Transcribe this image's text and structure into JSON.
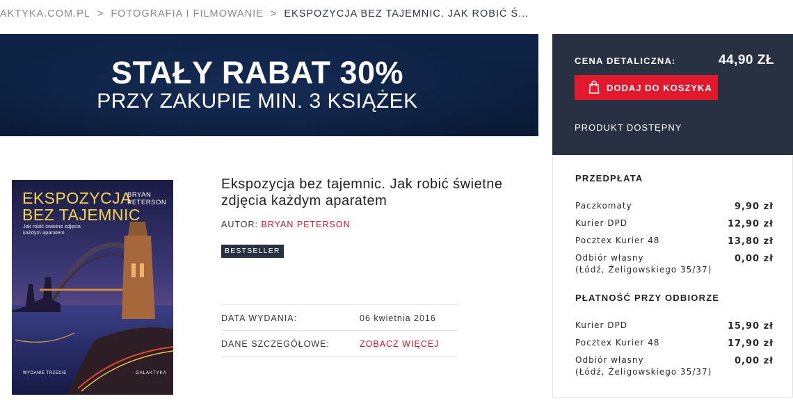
{
  "breadcrumb": {
    "items": [
      "AKTYKA.COM.PL",
      "FOTOGRAFIA I FILMOWANIE",
      "EKSPOZYCJA BEZ TAJEMNIC. JAK ROBIĆ Ś..."
    ],
    "separator": ">"
  },
  "banner": {
    "line1": "STAŁY RABAT 30%",
    "line2": "PRZY ZAKUPIE MIN. 3 KSIĄŻEK"
  },
  "purchase": {
    "price_label": "CENA DETALICZNA:",
    "price_value": "44,90 ZŁ",
    "cart_button": "DODAJ DO KOSZYKA",
    "cart_icon": "shopping-bag-icon",
    "availability": "PRODUKT DOSTĘPNY"
  },
  "shipping": {
    "prepaid": {
      "heading": "PRZEDPŁATA",
      "options": [
        {
          "name": "Paczkomaty",
          "cost": "9,90 zł"
        },
        {
          "name": "Kurier DPD",
          "cost": "12,90 zł"
        },
        {
          "name": "Pocztex Kurier 48",
          "cost": "13,80 zł"
        },
        {
          "name": "Odbiór własny",
          "name2": "(Łódź, Żeligowskiego 35/37)",
          "cost": "0,00 zł"
        }
      ]
    },
    "cod": {
      "heading": "PŁATNOŚĆ PRZY ODBIORZE",
      "options": [
        {
          "name": "Kurier DPD",
          "cost": "15,90 zł"
        },
        {
          "name": "Pocztex Kurier 48",
          "cost": "17,90 zł"
        },
        {
          "name": "Odbiór własny",
          "name2": "(Łódź, Żeligowskiego 35/37)",
          "cost": "0,00 zł"
        }
      ]
    }
  },
  "cover": {
    "title_line1": "EKSPOZYCJA",
    "title_line2": "BEZ TAJEMNIC",
    "author_line1": "BRYAN",
    "author_line2": "PETERSON",
    "subtitle_line1": "Jak robić świetne zdjęcia",
    "subtitle_line2": "każdym aparatem",
    "edition": "WYDANIE TRZECIE",
    "publisher": "GALAKTYKA"
  },
  "product": {
    "title": "Ekspozycja bez tajemnic. Jak robić świetne zdjęcia każdym aparatem",
    "author_label": "AUTOR:",
    "author_name": "BRYAN PETERSON",
    "badge": "BESTSELLER",
    "details": {
      "date_label": "DATA WYDANIA:",
      "date_value": "06 kwietnia 2016",
      "more_label": "DANE SZCZEGÓŁOWE:",
      "more_link": "ZOBACZ WIĘCEJ"
    }
  },
  "colors": {
    "accent_red": "#e2192d",
    "dark_navy": "#283142",
    "banner_navy": "#0c1f3f",
    "cover_title_yellow": "#f3d44a"
  }
}
